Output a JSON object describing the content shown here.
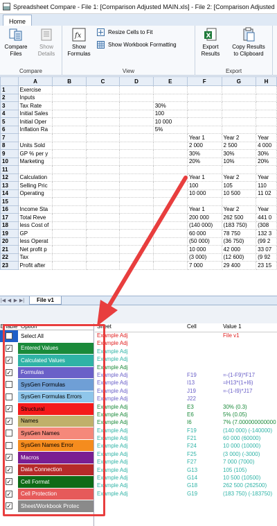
{
  "window": {
    "title": "Spreadsheet Compare - File 1: [Comparison Adjusted  MAIN.xls] - File 2: [Comparison Adjusted"
  },
  "ribbon": {
    "tab": "Home",
    "groups": [
      {
        "label": "Compare",
        "buttons": [
          {
            "line1": "Compare",
            "line2": "Files"
          },
          {
            "line1": "Show",
            "line2": "Details"
          }
        ]
      },
      {
        "label": "View",
        "show_formulas": {
          "line1": "Show",
          "line2": "Formulas"
        },
        "resize": "Resize Cells to Fit",
        "workbook_fmt": "Show Workbook Formatting"
      },
      {
        "label": "Export",
        "buttons": [
          {
            "line1": "Export",
            "line2": "Results"
          },
          {
            "line1": "Copy Results",
            "line2": "to Clipboard"
          }
        ]
      }
    ]
  },
  "sheet": {
    "columns": [
      "A",
      "B",
      "C",
      "D",
      "E",
      "F",
      "G",
      "H"
    ],
    "rows": [
      {
        "n": "1",
        "a": "Exercise",
        "e": "",
        "f": "",
        "g": "",
        "h": ""
      },
      {
        "n": "2",
        "a": "Inputs",
        "e": "",
        "f": "",
        "g": "",
        "h": ""
      },
      {
        "n": "3",
        "a": "Tax Rate",
        "e": "30%",
        "f": "",
        "g": "",
        "h": ""
      },
      {
        "n": "4",
        "a": "Initial Sales",
        "e": "100",
        "f": "",
        "g": "",
        "h": ""
      },
      {
        "n": "5",
        "a": "Initial Oper",
        "e": "10 000",
        "f": "",
        "g": "",
        "h": ""
      },
      {
        "n": "6",
        "a": "Inflation Ra",
        "e": "5%",
        "f": "",
        "g": "",
        "h": ""
      },
      {
        "n": "7",
        "a": "",
        "e": "",
        "f": "Year 1",
        "g": "Year 2",
        "h": "Year"
      },
      {
        "n": "8",
        "a": "Units Sold",
        "e": "",
        "f": "2 000",
        "g": "2 500",
        "h": "4 000"
      },
      {
        "n": "9",
        "a": "GP % per y",
        "e": "",
        "f": "30%",
        "g": "30%",
        "h": "30%"
      },
      {
        "n": "10",
        "a": "Marketing",
        "e": "",
        "f": "20%",
        "g": "10%",
        "h": "20%"
      },
      {
        "n": "11",
        "a": "",
        "e": "",
        "f": "",
        "g": "",
        "h": ""
      },
      {
        "n": "12",
        "a": "Calculation",
        "e": "",
        "f": "Year 1",
        "g": "Year 2",
        "h": "Year"
      },
      {
        "n": "13",
        "a": "Selling Pric",
        "e": "",
        "f": "100",
        "g": "105",
        "h": "110"
      },
      {
        "n": "14",
        "a": "Operating",
        "e": "",
        "f": "10 000",
        "g": "10 500",
        "h": "11 02"
      },
      {
        "n": "15",
        "a": "",
        "e": "",
        "f": "",
        "g": "",
        "h": ""
      },
      {
        "n": "16",
        "a": "Income Sta",
        "e": "",
        "f": "Year 1",
        "g": "Year 2",
        "h": "Year"
      },
      {
        "n": "17",
        "a": "Total Reve",
        "e": "",
        "f": "200 000",
        "g": "262 500",
        "h": "441 0"
      },
      {
        "n": "18",
        "a": "less Cost of",
        "e": "",
        "f": "(140 000)",
        "g": "(183 750)",
        "h": "(308"
      },
      {
        "n": "19",
        "a": "GP",
        "e": "",
        "f": "60 000",
        "g": "78 750",
        "h": "132 3"
      },
      {
        "n": "20",
        "a": "less Operat",
        "e": "",
        "f": "(50 000)",
        "g": "(36 750)",
        "h": "(99 2"
      },
      {
        "n": "21",
        "a": "Net profit p",
        "e": "",
        "f": "10 000",
        "g": "42 000",
        "h": "33 07"
      },
      {
        "n": "22",
        "a": "Tax",
        "e": "",
        "f": "(3 000)",
        "g": "(12 600)",
        "h": "(9 92"
      },
      {
        "n": "23",
        "a": "Profit after",
        "e": "",
        "f": "7 000",
        "g": "29 400",
        "h": "23 15"
      }
    ],
    "tab": "File v1"
  },
  "options": {
    "headers": {
      "enable": "Enable",
      "option": "Option"
    },
    "items": [
      {
        "label": "Select All",
        "color": "#ffffff",
        "text": "#000000",
        "checked": false,
        "select": true
      },
      {
        "label": "Entered Values",
        "color": "#1a8a3a",
        "text": "#ffffff",
        "checked": true
      },
      {
        "label": "Calculated Values",
        "color": "#2fb3a6",
        "text": "#ffffff",
        "checked": true
      },
      {
        "label": "Formulas",
        "color": "#6a60c8",
        "text": "#ffffff",
        "checked": true
      },
      {
        "label": "SysGen Formulas",
        "color": "#6f9fd6",
        "text": "#000000",
        "checked": false
      },
      {
        "label": "SysGen Formulas Errors",
        "color": "#8fc6ea",
        "text": "#000000",
        "checked": false
      },
      {
        "label": "Structural",
        "color": "#f41a1a",
        "text": "#000000",
        "checked": true
      },
      {
        "label": "Names",
        "color": "#c0b06a",
        "text": "#000000",
        "checked": true
      },
      {
        "label": "SysGen Names",
        "color": "#f5887a",
        "text": "#000000",
        "checked": false
      },
      {
        "label": "SysGen Names Error",
        "color": "#f58c1e",
        "text": "#000000",
        "checked": false
      },
      {
        "label": "Macros",
        "color": "#7a1e92",
        "text": "#ffffff",
        "checked": true
      },
      {
        "label": "Data Connection",
        "color": "#b62a2a",
        "text": "#ffffff",
        "checked": true
      },
      {
        "label": "Cell Format",
        "color": "#0e6a16",
        "text": "#ffffff",
        "checked": true
      },
      {
        "label": "Cell Protection",
        "color": "#e65a5a",
        "text": "#ffffff",
        "checked": true
      },
      {
        "label": "Sheet/Workbook Protec",
        "color": "#8a8a8a",
        "text": "#ffffff",
        "checked": true
      }
    ]
  },
  "results": {
    "headers": {
      "sheet": "Sheet",
      "cell": "Cell",
      "value": "Value 1"
    },
    "rows": [
      {
        "sheet": "Example Adj",
        "cell": "",
        "value": "File v1",
        "color": "#e02020",
        "vcolor": "#e02020"
      },
      {
        "sheet": "Example Adj",
        "cell": "",
        "value": "",
        "color": "#e02020",
        "vcolor": "#e02020"
      },
      {
        "sheet": "Example Adj",
        "cell": "",
        "value": "",
        "color": "#2fb3a6",
        "vcolor": "#2fb3a6"
      },
      {
        "sheet": "Example Adj",
        "cell": "",
        "value": "",
        "color": "#2fb3a6",
        "vcolor": "#2fb3a6"
      },
      {
        "sheet": "Example Adj",
        "cell": "",
        "value": "",
        "color": "#1a8a3a",
        "vcolor": "#1a8a3a"
      },
      {
        "sheet": "Example Adj",
        "cell": "F19",
        "value": "=-(1-F9)*F17",
        "color": "#6a60c8",
        "vcolor": "#6a60c8"
      },
      {
        "sheet": "Example Adj",
        "cell": "I13",
        "value": "=H13*(1+I6)",
        "color": "#6a60c8",
        "vcolor": "#6a60c8"
      },
      {
        "sheet": "Example Adj",
        "cell": "J19",
        "value": "=-(1-I9)*J17",
        "color": "#6a60c8",
        "vcolor": "#6a60c8"
      },
      {
        "sheet": "Example Adj",
        "cell": "J22",
        "value": "",
        "color": "#6a60c8",
        "vcolor": "#6a60c8"
      },
      {
        "sheet": "Example Adj",
        "cell": "E3",
        "value": "30% (0.3)",
        "color": "#1a8a3a",
        "vcolor": "#1a8a3a"
      },
      {
        "sheet": "Example Adj",
        "cell": "E6",
        "value": "5% (0.05)",
        "color": "#1a8a3a",
        "vcolor": "#1a8a3a"
      },
      {
        "sheet": "Example Adj",
        "cell": "I6",
        "value": "7% (7.000000000000",
        "color": "#1a8a3a",
        "vcolor": "#1a8a3a"
      },
      {
        "sheet": "Example Adj",
        "cell": "F19",
        "value": "(140 000) (-140000)",
        "color": "#2fb3a6",
        "vcolor": "#2fb3a6"
      },
      {
        "sheet": "Example Adj",
        "cell": "F21",
        "value": "60 000  (60000)",
        "color": "#2fb3a6",
        "vcolor": "#2fb3a6"
      },
      {
        "sheet": "Example Adj",
        "cell": "F24",
        "value": "10 000  (10000)",
        "color": "#2fb3a6",
        "vcolor": "#2fb3a6"
      },
      {
        "sheet": "Example Adj",
        "cell": "F25",
        "value": "(3 000) (-3000)",
        "color": "#2fb3a6",
        "vcolor": "#2fb3a6"
      },
      {
        "sheet": "Example Adj",
        "cell": "F27",
        "value": "7 000  (7000)",
        "color": "#2fb3a6",
        "vcolor": "#2fb3a6"
      },
      {
        "sheet": "Example Adj",
        "cell": "G13",
        "value": "105  (105)",
        "color": "#2fb3a6",
        "vcolor": "#2fb3a6"
      },
      {
        "sheet": "Example Adj",
        "cell": "G14",
        "value": "10 500  (10500)",
        "color": "#2fb3a6",
        "vcolor": "#2fb3a6"
      },
      {
        "sheet": "Example Adj",
        "cell": "G18",
        "value": "262 500  (262500)",
        "color": "#2fb3a6",
        "vcolor": "#2fb3a6"
      },
      {
        "sheet": "Example Adj",
        "cell": "G19",
        "value": "(183 750) (-183750)",
        "color": "#2fb3a6",
        "vcolor": "#2fb3a6"
      }
    ]
  },
  "colors": {
    "annotation": "#e83e3e",
    "header_bg": "#e7eef7"
  }
}
